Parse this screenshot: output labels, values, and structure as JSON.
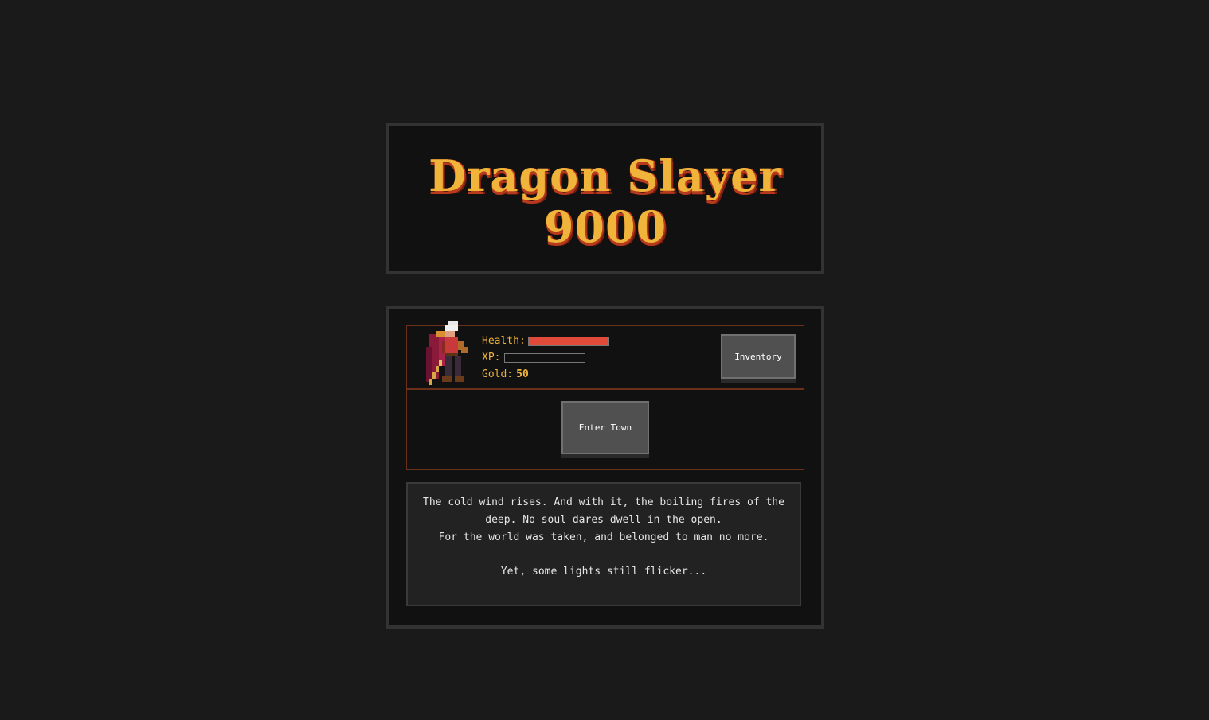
{
  "title": {
    "line1": "Dragon Slayer",
    "line2": "9000"
  },
  "player": {
    "avatar_icon": "caped-knight-sprite-icon",
    "health_label": "Health:",
    "health_fraction": 1.0,
    "xp_label": "XP:",
    "xp_fraction": 0.0,
    "gold_label": "Gold:",
    "gold_value": "50"
  },
  "buttons": {
    "inventory": "Inventory",
    "enter_town": "Enter Town"
  },
  "story": {
    "line1": "The cold wind rises. And with it, the boiling fires of the deep. No soul dares dwell in the open.",
    "line2": "For the world was taken, and belonged to man no more.",
    "line3": "Yet, some lights still flicker..."
  },
  "colors": {
    "accent_gold": "#f0b43a",
    "health_red": "#e04a3a",
    "frame_rust": "#6a3019"
  }
}
